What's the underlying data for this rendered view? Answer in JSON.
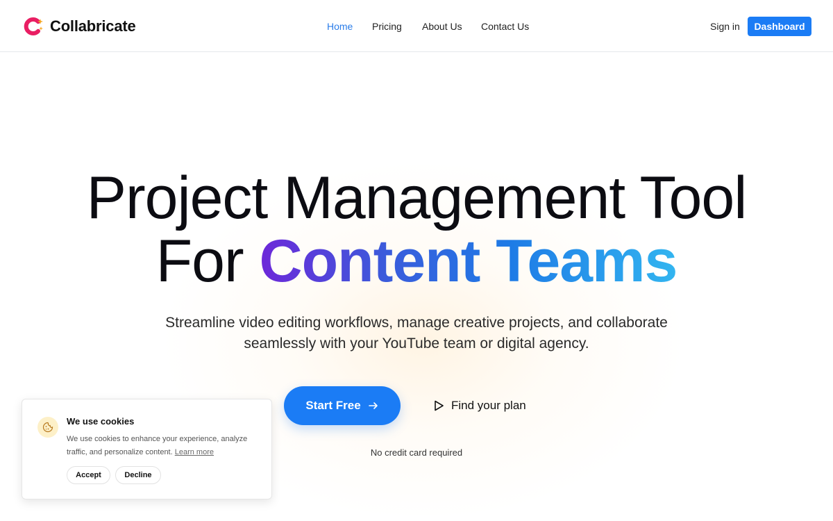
{
  "brand": {
    "name": "Collabricate"
  },
  "nav": {
    "items": [
      {
        "label": "Home",
        "active": true
      },
      {
        "label": "Pricing"
      },
      {
        "label": "About Us"
      },
      {
        "label": "Contact Us"
      }
    ]
  },
  "header": {
    "signin_label": "Sign in",
    "dashboard_label": "Dashboard"
  },
  "hero": {
    "title_line1": "Project Management Tool",
    "title_line2_plain": "For ",
    "title_line2_highlight": "Content Teams",
    "subtitle_line1": "Streamline video editing workflows, manage creative projects, and collaborate",
    "subtitle_line2": "seamlessly with your YouTube team or digital agency.",
    "cta_primary": "Start Free",
    "cta_primary_icon": "arrow-right-icon",
    "cta_secondary": "Find your plan",
    "cta_secondary_icon": "play-icon",
    "note": "No credit card required"
  },
  "cookie": {
    "icon": "cookie-icon",
    "title": "We use cookies",
    "text": "We use cookies to enhance your experience, analyze traffic, and personalize content.",
    "learn_more": "Learn more",
    "accept_label": "Accept",
    "decline_label": "Decline"
  },
  "colors": {
    "accent": "#1b7cf5",
    "nav_active": "#2b7de9",
    "gradient_start": "#6d28d9",
    "gradient_end": "#33b5f0",
    "logo_pink": "#e91e63",
    "logo_star": "#f5a623"
  }
}
